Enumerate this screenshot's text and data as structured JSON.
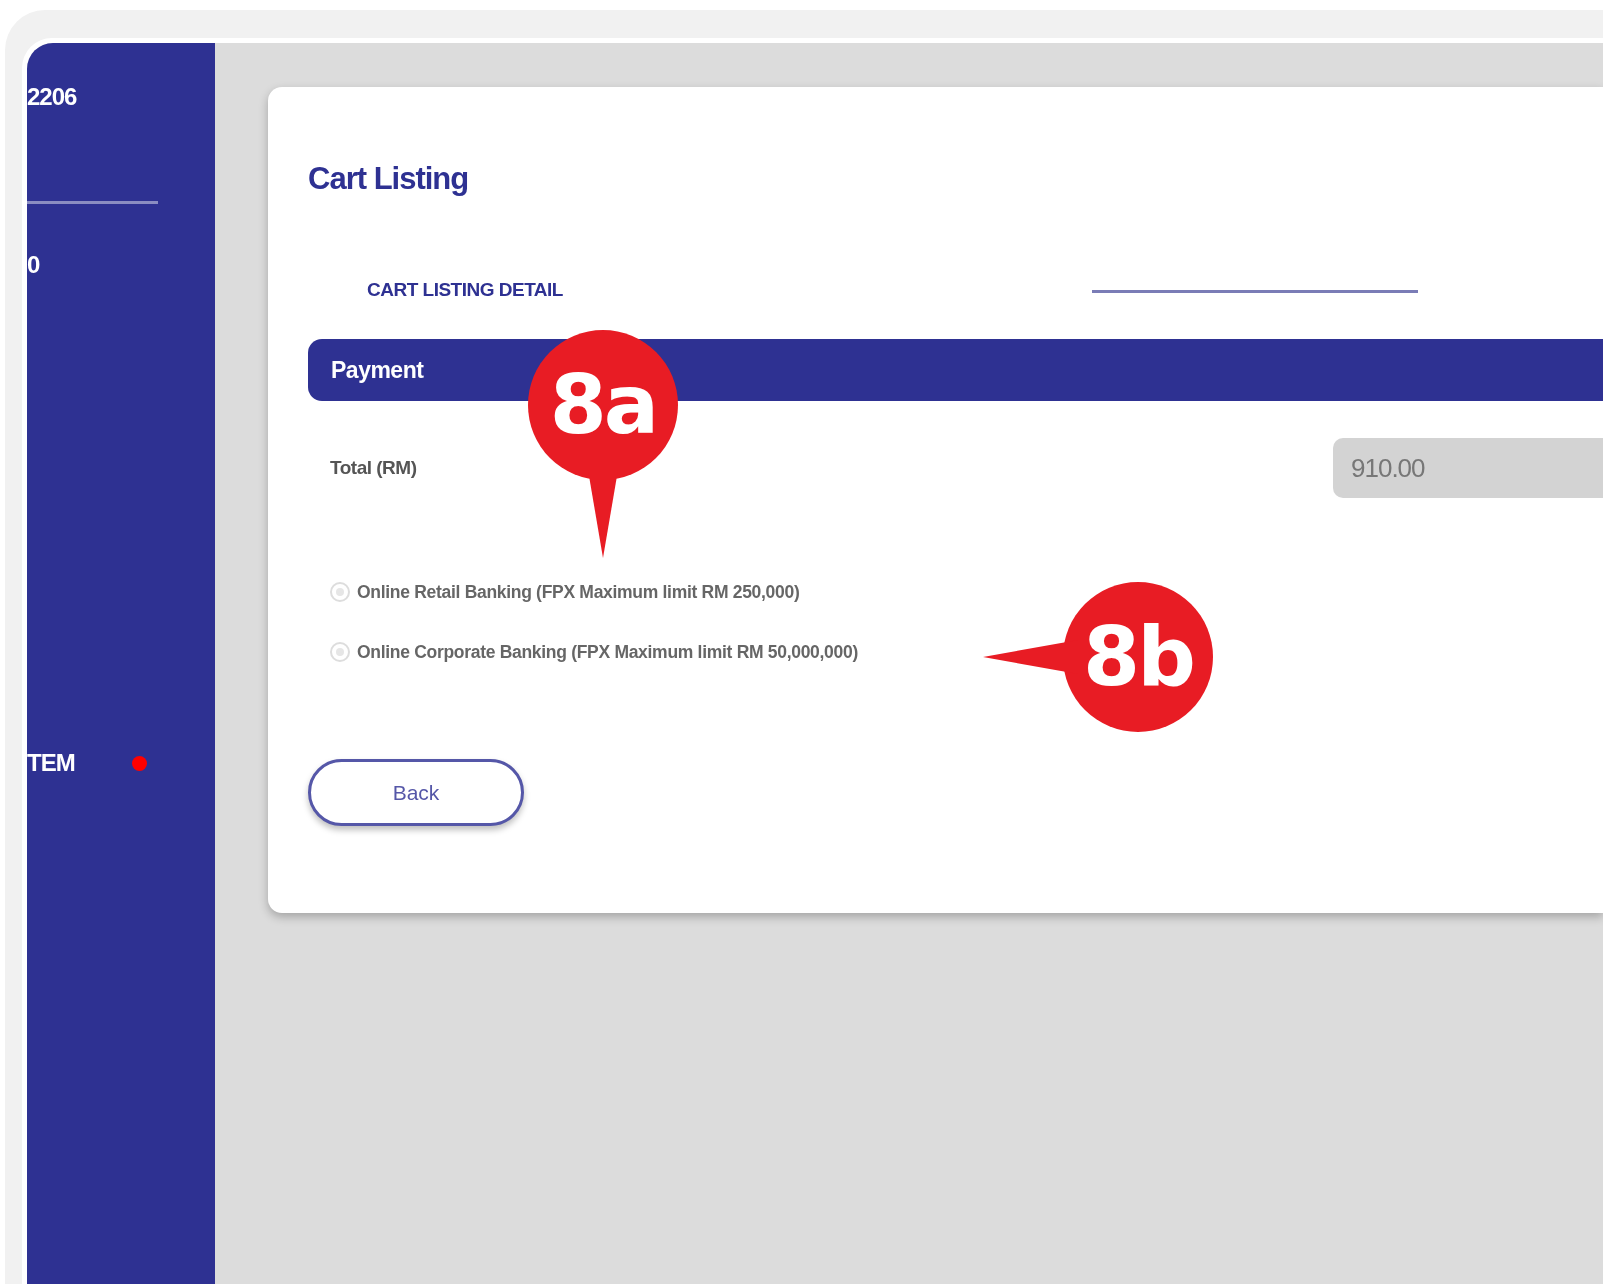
{
  "sidebar": {
    "account": "2206",
    "item": "0",
    "menu_item": {
      "label": "TEM",
      "notification": true
    }
  },
  "page": {
    "title": "Cart Listing",
    "tabs": [
      {
        "label": "CART LISTING DETAIL",
        "selected": false
      }
    ],
    "section": "Payment",
    "total": {
      "label": "Total (RM)",
      "value": "910.00"
    },
    "payment_options": [
      {
        "label": "Online Retail Banking (FPX Maximum limit RM 250,000)",
        "selected": false
      },
      {
        "label": "Online Corporate Banking (FPX Maximum limit RM 50,000,000)",
        "selected": false
      }
    ],
    "back_button": "Back"
  },
  "callouts": [
    {
      "label": "8a",
      "kind": "down"
    },
    {
      "label": "8b",
      "kind": "left"
    }
  ]
}
